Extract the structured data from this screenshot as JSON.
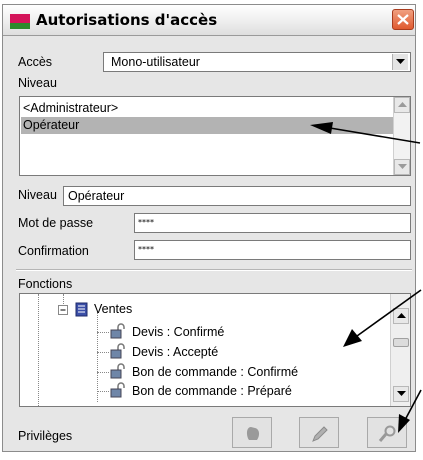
{
  "window": {
    "title": "Autorisations d'accès",
    "close_label": "Close"
  },
  "acces": {
    "label": "Accès",
    "value": "Mono-utilisateur"
  },
  "niveau_list": {
    "label": "Niveau",
    "items": [
      "<Administrateur>",
      "Opérateur"
    ],
    "selected": "Opérateur"
  },
  "form": {
    "niveau_label": "Niveau",
    "niveau_value": "Opérateur",
    "password_label": "Mot de passe",
    "password_value": "****",
    "confirm_label": "Confirmation",
    "confirm_value": "****"
  },
  "fonctions": {
    "label": "Fonctions",
    "group": "Ventes",
    "items": [
      "Devis : Confirmé",
      "Devis : Accepté",
      "Bon de commande : Confirmé",
      "Bon de commande : Préparé"
    ]
  },
  "privileges": {
    "label": "Privilèges",
    "buttons": [
      "grant-icon",
      "edit-icon",
      "revoke-icon"
    ]
  },
  "colors": {
    "selection": "#b3b3b3",
    "title_icon_top": "#d4145a",
    "title_icon_bottom": "#2c8a2c",
    "close": "#e05a30"
  }
}
